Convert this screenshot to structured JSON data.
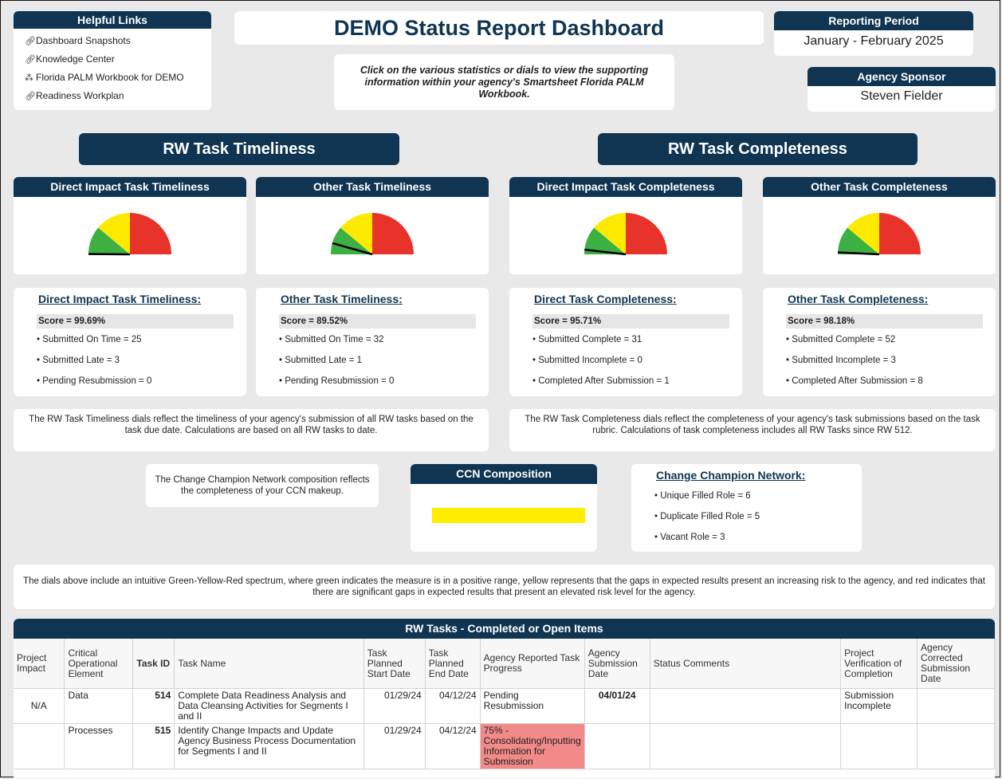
{
  "links": {
    "title": "Helpful Links",
    "items": [
      {
        "label": "Dashboard Snapshots",
        "icon": "link-icon"
      },
      {
        "label": "Knowledge Center",
        "icon": "link-icon"
      },
      {
        "label": "Florida PALM Workbook for DEMO",
        "icon": "workbook-icon"
      },
      {
        "label": "Readiness Workplan",
        "icon": "link-icon"
      }
    ]
  },
  "title": "DEMO Status Report Dashboard",
  "instruction": "Click on the various statistics or dials to view the supporting information within your agency's Smartsheet Florida PALM Workbook.",
  "period": {
    "title": "Reporting Period",
    "value": "January - February 2025"
  },
  "sponsor": {
    "title": "Agency Sponsor",
    "value": "Steven Fielder"
  },
  "sections": {
    "timeliness": "RW Task Timeliness",
    "completeness": "RW Task Completeness"
  },
  "dials": [
    {
      "title": "Direct Impact Task Timeliness",
      "needle_score": 99.69
    },
    {
      "title": "Other Task Timeliness",
      "needle_score": 89.52
    },
    {
      "title": "Direct Impact Task Completeness",
      "needle_score": 95.71
    },
    {
      "title": "Other Task Completeness",
      "needle_score": 98.18
    }
  ],
  "dial_colors": {
    "green": "#3cb043",
    "yellow": "#fdea00",
    "red": "#e8332a",
    "needle": "#000000"
  },
  "stats": [
    {
      "header": "Direct Impact Task Timeliness:",
      "score": "Score = 99.69%",
      "lines": [
        "• Submitted On Time = 25",
        "• Submitted Late = 3",
        "• Pending Resubmission = 0"
      ]
    },
    {
      "header": "Other Task Timeliness:",
      "score": "Score = 89.52%",
      "lines": [
        "• Submitted On Time = 32",
        "• Submitted Late = 1",
        "• Pending Resubmission = 0"
      ]
    },
    {
      "header": "Direct Task Completeness:",
      "score": "Score = 95.71%",
      "lines": [
        "• Submitted Complete = 31",
        "• Submitted Incomplete = 0",
        "• Completed After Submission = 1"
      ]
    },
    {
      "header": "Other Task Completeness:",
      "score": "Score = 98.18%",
      "lines": [
        "• Submitted Complete = 52",
        "• Submitted Incomplete = 3",
        "• Completed After Submission = 8"
      ]
    }
  ],
  "notes": {
    "timeliness": "The RW Task Timeliness dials reflect the timeliness of your agency's submission of all RW tasks based on the task due date. Calculations are based on all RW tasks to date.",
    "completeness": "The RW Task Completeness dials reflect the completeness of your agency's task submissions based on the task rubric. Calculations of task completeness includes all RW Tasks since RW 512.",
    "ccn": "The Change Champion Network composition reflects the completeness of your CCN makeup.",
    "spectrum": "The dials above include an intuitive Green-Yellow-Red spectrum, where green indicates the measure is in a positive range, yellow represents that the gaps in expected results present an increasing risk to the agency, and red indicates that there are significant gaps in expected results that present an elevated risk level for the agency."
  },
  "ccn": {
    "title": "CCN Composition",
    "bar_color": "#ffec00",
    "bar_fill": 1.0
  },
  "ccnstat": {
    "header": "Change Champion Network:",
    "lines": [
      "• Unique Filled Role = 6",
      "• Duplicate Filled Role = 5",
      "• Vacant Role = 3"
    ]
  },
  "table": {
    "title": "RW Tasks - Completed or Open Items",
    "columns": [
      "Project Impact",
      "Critical Operational Element",
      "Task ID",
      "Task Name",
      "Task Planned Start Date",
      "Task Planned End Date",
      "Agency Reported Task Progress",
      "Agency Submission Date",
      "Status Comments",
      "Project Verification of Completion",
      "Agency Corrected Submission Date"
    ],
    "rows": [
      {
        "impact": "N/A",
        "element": "Data",
        "id": "514",
        "name": "Complete Data Readiness Analysis and Data Cleansing Activities for Segments I and II",
        "start": "01/29/24",
        "end": "04/12/24",
        "progress": "Pending Resubmission",
        "submission": "04/01/24",
        "comments": "",
        "verification": "Submission Incomplete",
        "corrected": ""
      },
      {
        "impact": "",
        "element": "Processes",
        "id": "515",
        "name": "Identify Change Impacts and Update Agency Business Process Documentation for Segments I and II",
        "start": "01/29/24",
        "end": "04/12/24",
        "progress": "75% - Consolidating/Inputting Information for Submission",
        "submission": "",
        "comments": "",
        "verification": "",
        "corrected": ""
      }
    ]
  }
}
